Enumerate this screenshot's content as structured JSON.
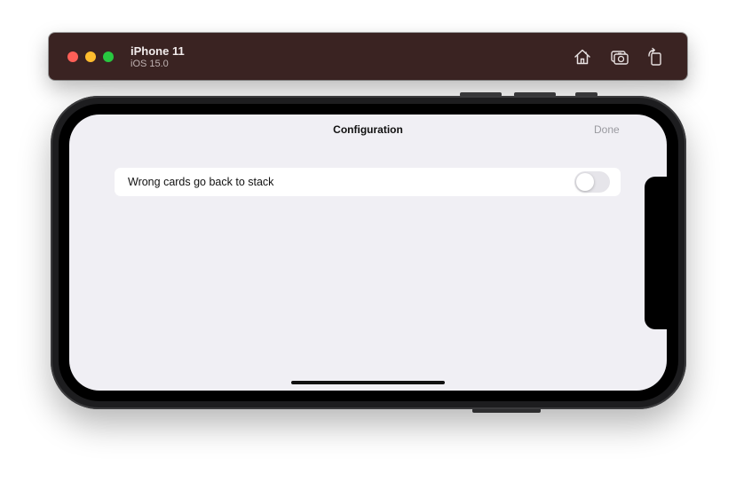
{
  "colors": {
    "titlebar_bg": "#3a2322",
    "traffic_close": "#fe5f57",
    "traffic_minimize": "#febc2e",
    "traffic_zoom": "#28c840",
    "screen_bg": "#f0eff4",
    "toggle_off_track": "#e6e5ea"
  },
  "simulator": {
    "device_name": "iPhone 11",
    "os_version": "iOS 15.0",
    "icons": [
      "home-icon",
      "screenshot-icon",
      "rotate-icon"
    ]
  },
  "navbar": {
    "title": "Configuration",
    "done_label": "Done"
  },
  "settings": {
    "rows": [
      {
        "label": "Wrong cards go back to stack",
        "toggle_on": false
      }
    ]
  }
}
